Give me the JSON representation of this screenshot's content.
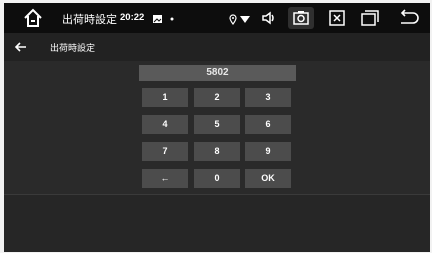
{
  "status_bar": {
    "title": "出荷時設定",
    "time": "20:22",
    "icons": [
      "home-icon",
      "notification-image-icon",
      "dot-icon",
      "location-icon",
      "wifi-icon",
      "volume-icon",
      "screenshot-icon",
      "close-box-icon",
      "recent-apps-icon",
      "back-icon"
    ]
  },
  "app_bar": {
    "title": "出荷時設定"
  },
  "keypad": {
    "display": "5802",
    "keys": [
      "1",
      "2",
      "3",
      "4",
      "5",
      "6",
      "7",
      "8",
      "9",
      "←",
      "0",
      "OK"
    ]
  }
}
